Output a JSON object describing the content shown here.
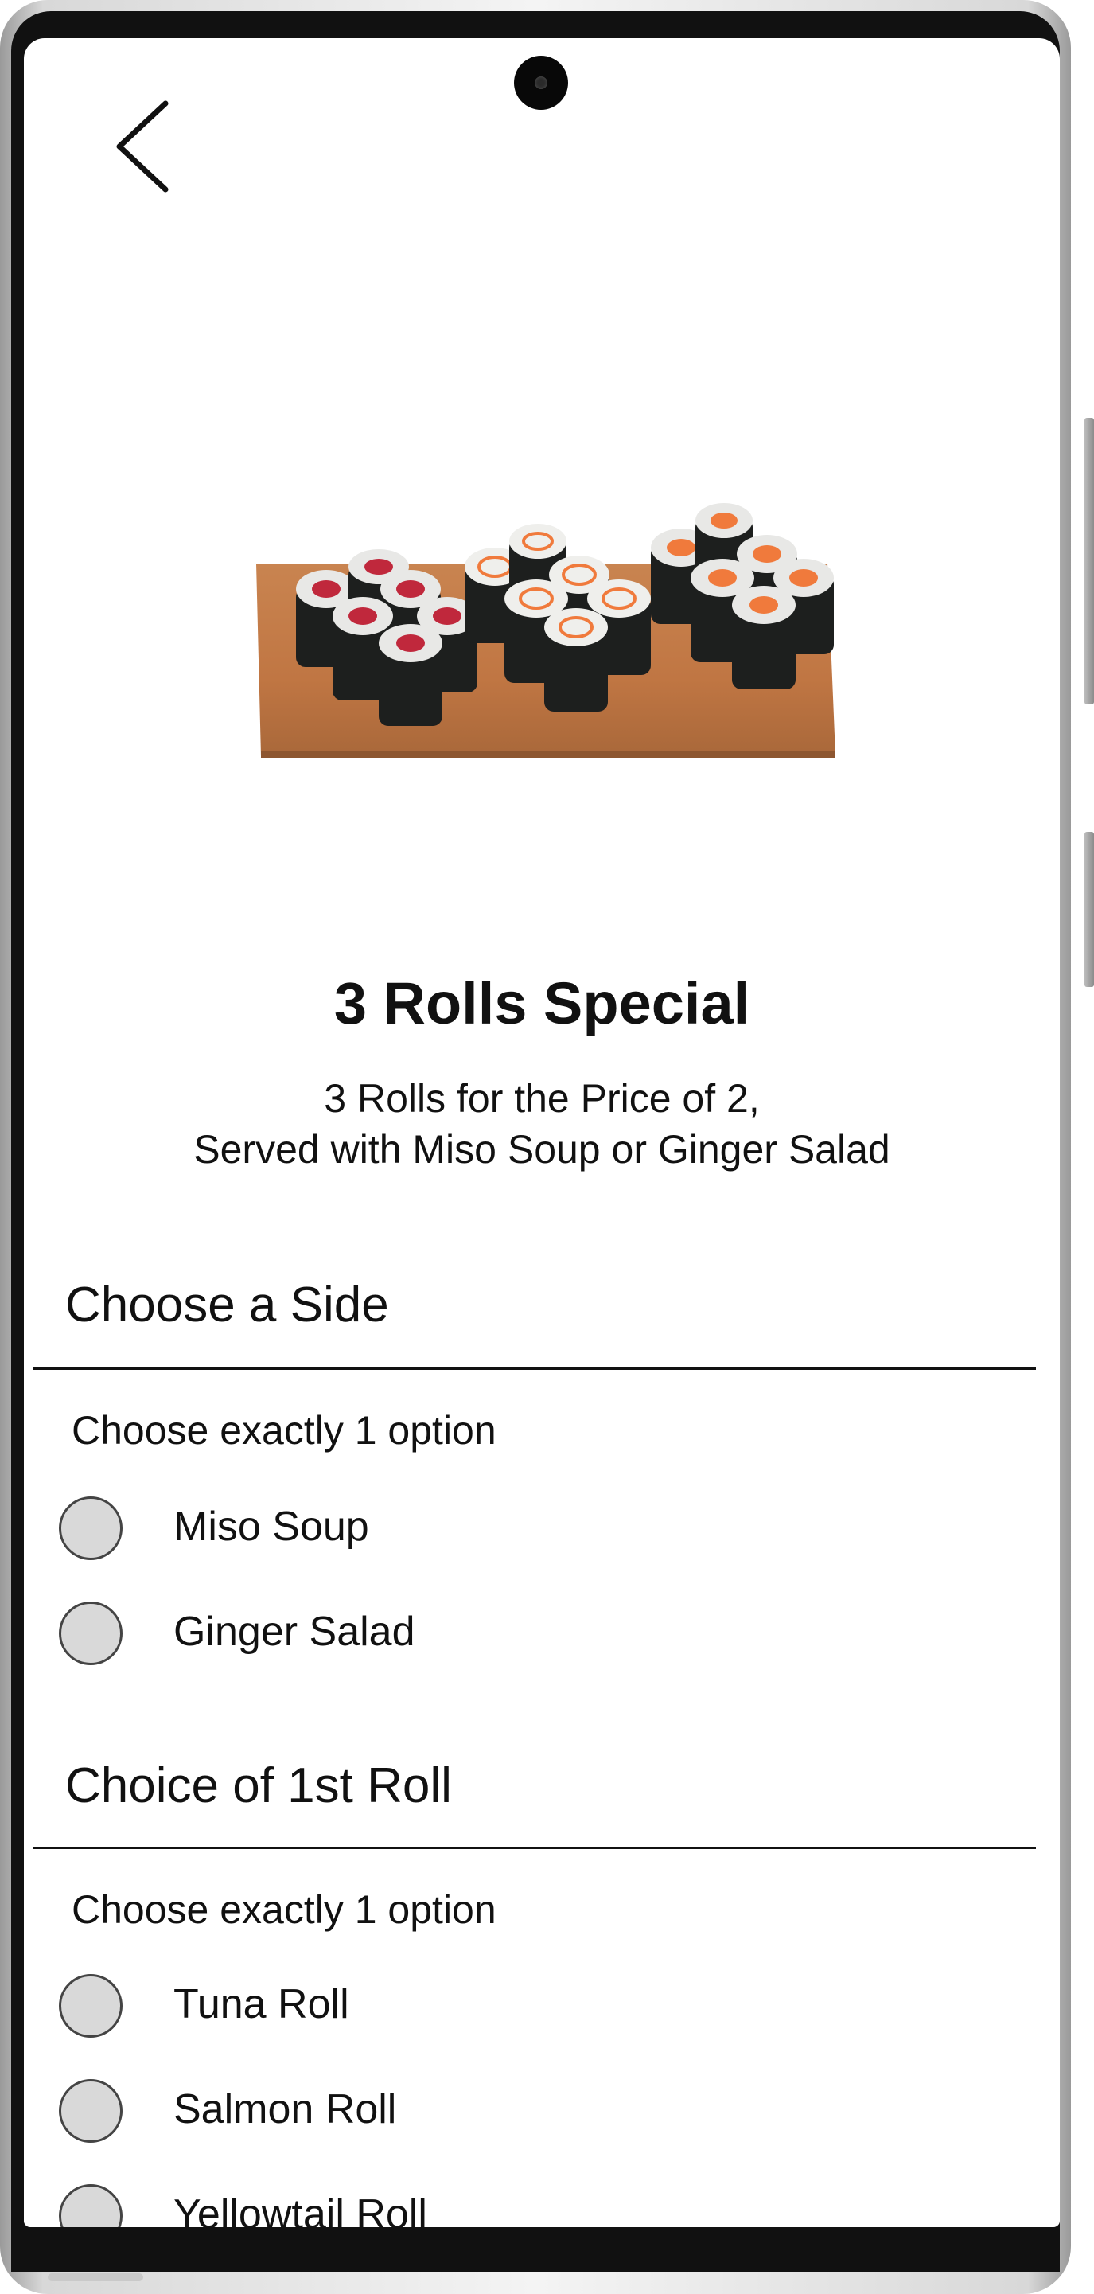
{
  "header": {
    "back_icon": "chevron-left-icon"
  },
  "hero": {
    "image_subject": "sushi-rolls-on-wooden-board"
  },
  "item": {
    "title": "3 Rolls Special",
    "description_line1": "3 Rolls for the Price of 2,",
    "description_line2": "Served with Miso Soup or Ginger Salad"
  },
  "sections": [
    {
      "heading": "Choose a Side",
      "helper": "Choose exactly 1 option",
      "options": [
        {
          "label": "Miso Soup",
          "selected": false
        },
        {
          "label": "Ginger Salad",
          "selected": false
        }
      ]
    },
    {
      "heading": "Choice of 1st Roll",
      "helper": "Choose exactly 1 option",
      "options": [
        {
          "label": "Tuna Roll",
          "selected": false
        },
        {
          "label": "Salmon Roll",
          "selected": false
        },
        {
          "label": "Yellowtail Roll",
          "selected": false
        }
      ]
    }
  ],
  "colors": {
    "text": "#111111",
    "radio_fill": "#d9d9d9",
    "radio_border": "#444444",
    "board": "#c47a45",
    "tuna": "#c0283c",
    "salmon": "#f07a3c"
  }
}
